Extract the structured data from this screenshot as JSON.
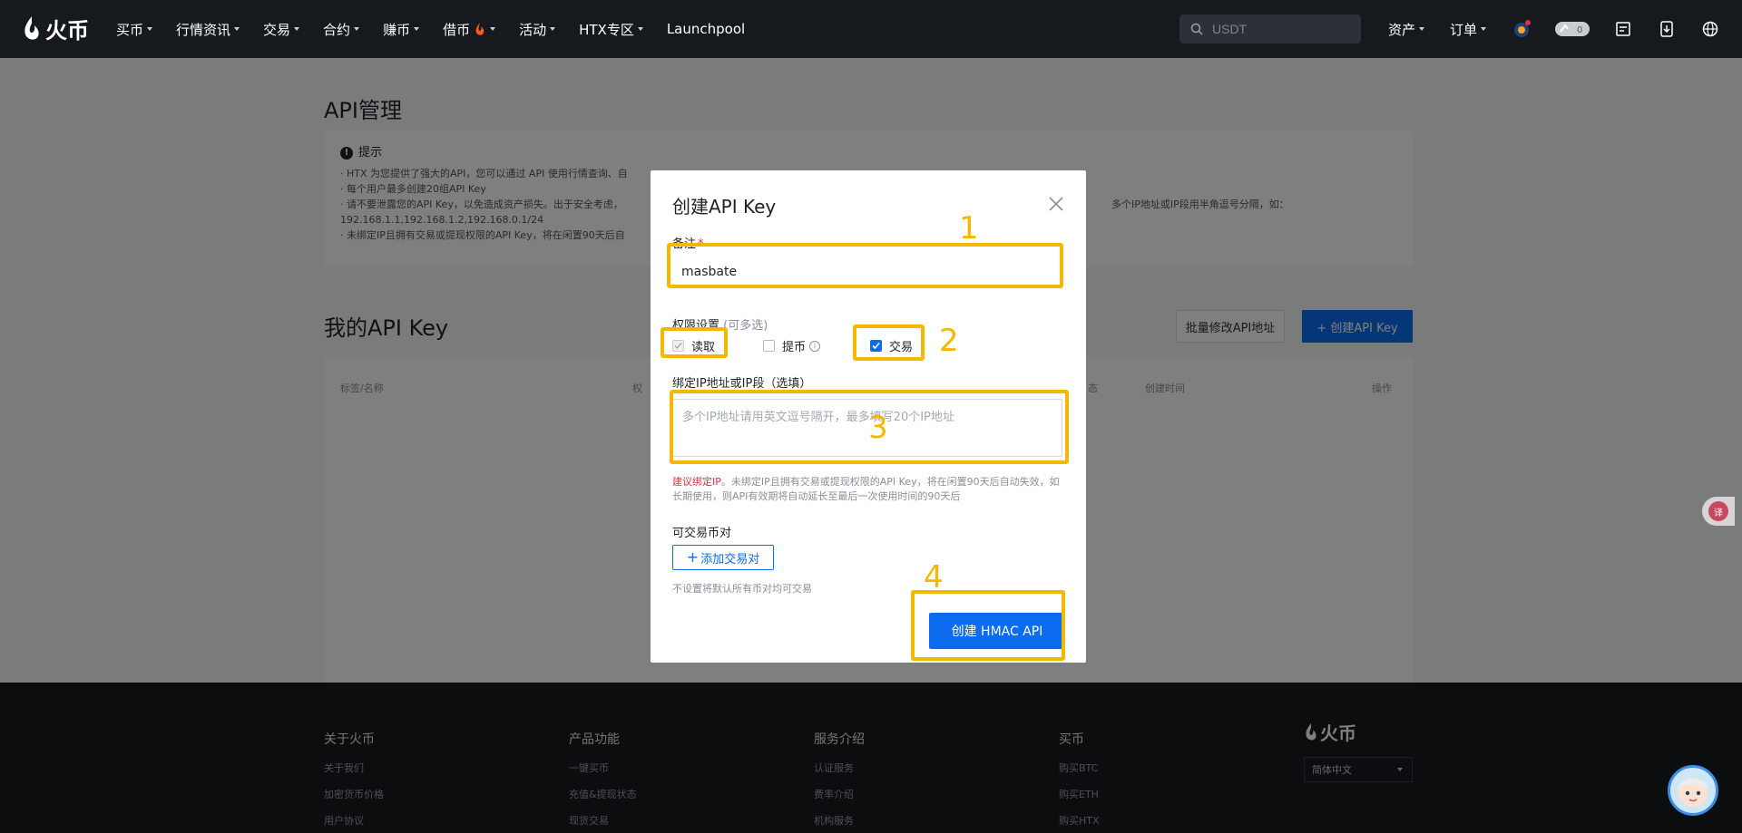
{
  "nav": {
    "logo": "火币",
    "items": [
      "买币",
      "行情资讯",
      "交易",
      "合约",
      "赚币",
      "借币",
      "活动",
      "HTX专区",
      "Launchpool"
    ],
    "search_placeholder": "USDT",
    "right_items": [
      "资产",
      "订单"
    ]
  },
  "page": {
    "title": "API管理",
    "tips_title": "提示",
    "tips": [
      "· HTX 为您提供了强大的API，您可以通过 API 使用行情查询、自",
      "· 每个用户最多创建20组API Key",
      "· 请不要泄露您的API Key，以免造成资产损失。出于安全考虑，",
      "  192.168.1.1,192.168.1.2,192.168.0.1/24",
      "· 未绑定IP且拥有交易或提现权限的API Key，将在闲置90天后自"
    ],
    "tips_right": "多个IP地址或IP段用半角逗号分隔，如：",
    "my_api_title": "我的API Key",
    "batch_button": "批量修改API地址",
    "create_button": "+ 创建API Key",
    "table_headers": [
      "标签/名称",
      "权",
      "态",
      "创建时间",
      "操作"
    ]
  },
  "footer": {
    "columns": [
      {
        "title": "关于火币",
        "links": [
          "关于我们",
          "加密货币价格",
          "用户协议"
        ]
      },
      {
        "title": "产品功能",
        "links": [
          "一键买币",
          "充值&提现状态",
          "现货交易"
        ]
      },
      {
        "title": "服务介绍",
        "links": [
          "认证服务",
          "费率介绍",
          "机构服务"
        ]
      },
      {
        "title": "买币",
        "links": [
          "购买BTC",
          "购买ETH",
          "购买HTX"
        ]
      }
    ],
    "logo": "火币",
    "language": "简体中文"
  },
  "modal": {
    "title": "创建API Key",
    "remark_label": "备注",
    "remark_required": "*",
    "remark_value": "masbate",
    "perm_label": "权限设置",
    "perm_hint": "(可多选)",
    "perm_read": "读取",
    "perm_withdraw": "提币",
    "perm_trade": "交易",
    "ip_label": "绑定IP地址或IP段（选填）",
    "ip_placeholder": "多个IP地址请用英文逗号隔开，最多填写20个IP地址",
    "warn_red": "建议绑定IP",
    "warn_text": "。未绑定IP且拥有交易或提现权限的API Key，将在闲置90天后自动失效，如长期使用，则API有效期将自动延长至最后一次使用时间的90天后",
    "pairs_label": "可交易币对",
    "add_pair": "添加交易对",
    "pair_hint": "不设置将默认所有币对均可交易",
    "submit": "创建 HMAC API"
  },
  "float": {
    "translate_icon": "译"
  },
  "annotations": {
    "color": "#f5b800",
    "labels": [
      "1",
      "2",
      "3",
      "4"
    ]
  }
}
